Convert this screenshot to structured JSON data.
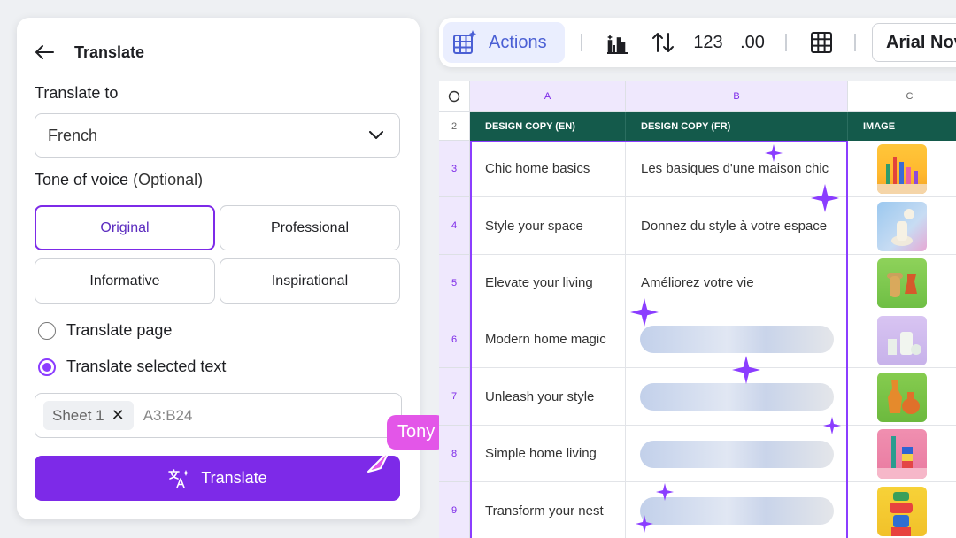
{
  "panel": {
    "title": "Translate",
    "translate_to_label": "Translate to",
    "language_value": "French",
    "tone_label": "Tone of voice",
    "tone_optional": "(Optional)",
    "tones": [
      "Original",
      "Professional",
      "Informative",
      "Inspirational"
    ],
    "selected_tone": "Original",
    "radio_options": [
      "Translate page",
      "Translate selected text"
    ],
    "selected_radio": "Translate selected text",
    "range_chip": "Sheet 1",
    "range_value": "A3:B24",
    "translate_button": "Translate"
  },
  "cursor": {
    "name": "Tony",
    "color": "#e356e8"
  },
  "toolbar": {
    "actions_label": "Actions",
    "number_format": "123",
    "decimal_format": ".00",
    "font_name": "Arial Nova"
  },
  "sheet": {
    "columns": [
      "A",
      "B",
      "C"
    ],
    "header_row_num": "2",
    "headers": [
      "DESIGN COPY (EN)",
      "DESIGN COPY (FR)",
      "IMAGE"
    ],
    "rows": [
      {
        "num": "3",
        "en": "Chic home basics",
        "fr": "Les basiques d'une maison chic"
      },
      {
        "num": "4",
        "en": "Style your space",
        "fr": "Donnez du style à votre espace"
      },
      {
        "num": "5",
        "en": "Elevate your living",
        "fr": "Améliorez votre vie"
      },
      {
        "num": "6",
        "en": "Modern home magic",
        "fr": ""
      },
      {
        "num": "7",
        "en": "Unleash your style",
        "fr": ""
      },
      {
        "num": "8",
        "en": "Simple home living",
        "fr": ""
      },
      {
        "num": "9",
        "en": "Transform your nest",
        "fr": ""
      }
    ]
  },
  "colors": {
    "accent": "#7d2ae8",
    "header_green": "#145a4b",
    "actions_blue": "#4a5fd4",
    "sparkle": "#8b3dff"
  }
}
